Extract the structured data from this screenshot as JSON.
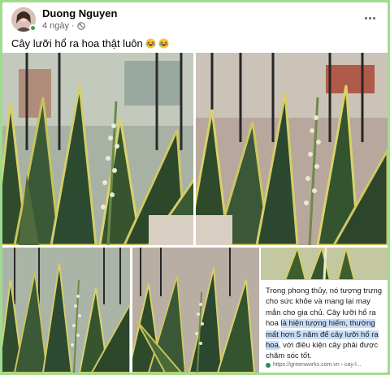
{
  "post": {
    "author": "Duong Nguyen",
    "time": "4 ngày",
    "separator": "·",
    "text": "Cây lưỡi hổ ra hoa thật luôn",
    "emojis": [
      "laughing-emoji",
      "laughing-emoji"
    ]
  },
  "icons": {
    "audience": "globe-icon",
    "more": "more-options-icon"
  },
  "snippet": {
    "text_before": "Trong phong thủy, nó tượng trưng cho sức khỏe và mang lại may mắn cho gia chủ. Cây lưỡi hổ ra hoa ",
    "text_highlight": "là hiện tượng hiếm, thường mất hơn 5 năm để cây lưỡi hổ ra hoa",
    "text_after": ", với điều kiện cây phải được chăm sóc tốt.",
    "source": "https://greenworks.com.vn › cay-l..."
  },
  "colors": {
    "page_background": "#9fdc8f",
    "online": "#31a24c",
    "highlight": "#c7dcf7"
  }
}
